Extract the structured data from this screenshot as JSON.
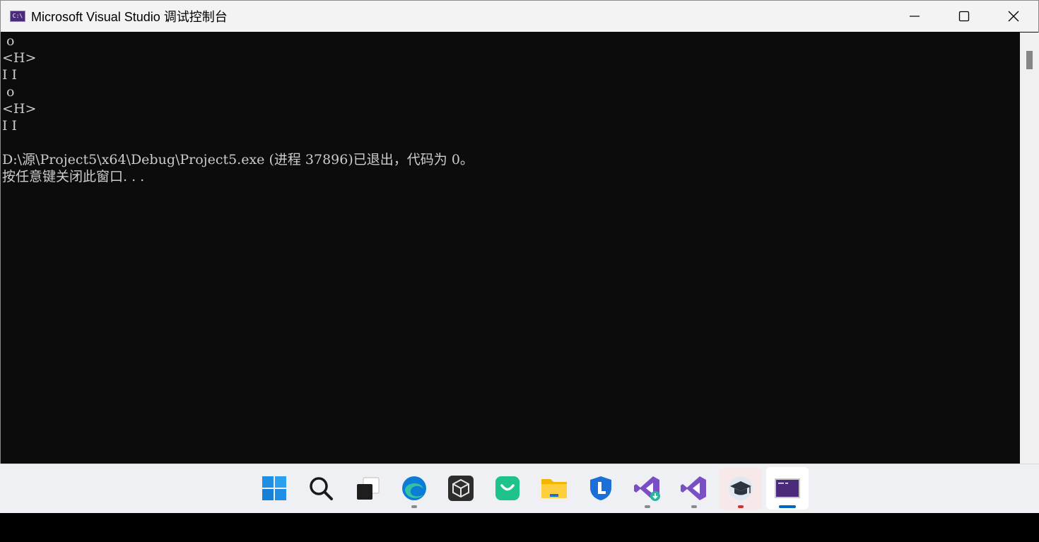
{
  "window": {
    "title": "Microsoft Visual Studio 调试控制台",
    "icon_label": "C:\\",
    "controls": [
      "minimize-icon",
      "maximize-icon",
      "close-icon"
    ]
  },
  "console": {
    "lines": [
      " o",
      "<H>",
      "I I",
      " o",
      "<H>",
      "I I",
      "",
      "D:\\源\\Project5\\x64\\Debug\\Project5.exe (进程 37896)已退出，代码为 0。",
      "按任意键关闭此窗口. . ."
    ],
    "text_color": "#cccccc",
    "background": "#0c0c0c"
  },
  "taskbar": {
    "apps": [
      {
        "name": "start-icon"
      },
      {
        "name": "search-icon"
      },
      {
        "name": "task-view-icon"
      },
      {
        "name": "edge-icon",
        "running": true
      },
      {
        "name": "virtualbox-icon"
      },
      {
        "name": "shopping-bag-icon"
      },
      {
        "name": "file-explorer-icon"
      },
      {
        "name": "security-shield-icon"
      },
      {
        "name": "visual-studio-installer-icon",
        "running": true
      },
      {
        "name": "visual-studio-icon",
        "running": true
      },
      {
        "name": "graduation-cap-icon",
        "running": true,
        "highlight": "#d32f2f"
      },
      {
        "name": "terminal-icon",
        "running": true,
        "active": true,
        "highlight": "#0067c0"
      }
    ]
  }
}
